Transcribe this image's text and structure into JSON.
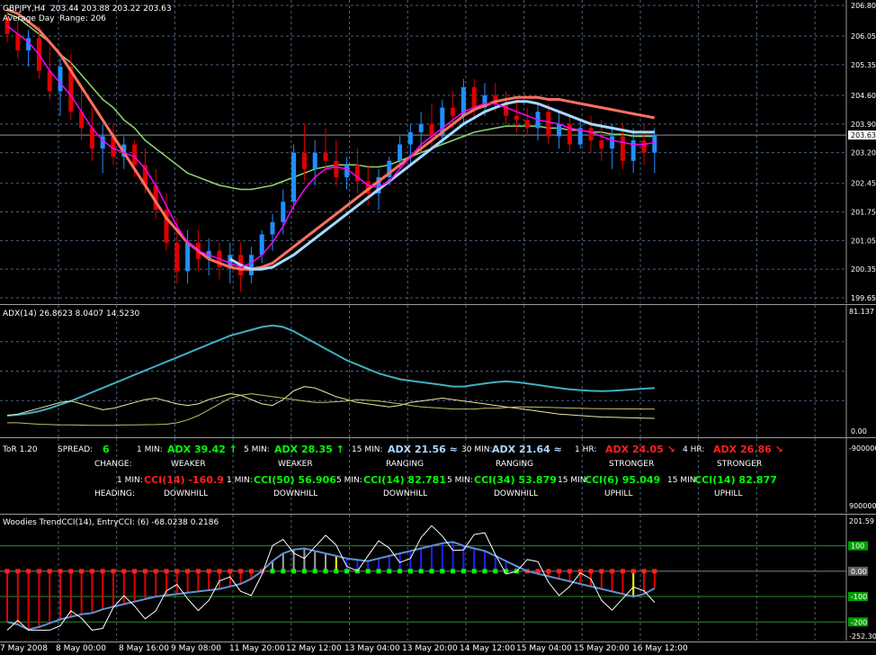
{
  "colors": {
    "bull": "#1e90ff",
    "bear": "#e00000",
    "fast_ma": "#ff00ff",
    "slow_ma": "#a8d8ff",
    "trend_ma": "#ff7060",
    "green_ma": "#90d870",
    "adx": "#40b0c0",
    "di": "#e8e8a0",
    "cci_bar_red": "#e00000",
    "cci_bar_blue": "#2020ff",
    "cci_bar_gray": "#a0a0a0",
    "cci_bar_yellow": "#ffff00",
    "cci_line": "#6090d0",
    "green": "#00ff00",
    "red": "#ff2020",
    "lightblue": "#b0d8ff"
  },
  "main": {
    "header_line1": "GBPJPY,H4  203.44 203.88 203.22 203.63",
    "header_line2": "Average Day  Range: 206",
    "current_price": "203.63",
    "price_ticks": [
      "206.80",
      "206.05",
      "205.35",
      "204.60",
      "203.90",
      "203.20",
      "202.45",
      "201.75",
      "201.05",
      "200.35",
      "199.65"
    ]
  },
  "adx_panel": {
    "header": "ADX(14) 26.8623 8.0407 14.5230",
    "top_tick": "81.137",
    "bottom_tick": "0.00"
  },
  "tor_panel": {
    "title": "ToR 1.20",
    "spread_label": "SPREAD:",
    "spread_value": "6",
    "change_label": "CHANGE:",
    "heading_label": "HEADING:",
    "tick_top": "-900000",
    "tick_bottom": "900000",
    "adx_cols": [
      {
        "tf": "1 MIN:",
        "adx": "ADX 39.42",
        "arrow": "↑",
        "state": "WEAKER",
        "color": "#00ff00"
      },
      {
        "tf": "5 MIN:",
        "adx": "ADX 28.35",
        "arrow": "↑",
        "state": "WEAKER",
        "color": "#00ff00"
      },
      {
        "tf": "15 MIN:",
        "adx": "ADX 21.56",
        "arrow": "≈",
        "state": "RANGING",
        "color": "#b0d8ff"
      },
      {
        "tf": "30 MIN:",
        "adx": "ADX 21.64",
        "arrow": "≈",
        "state": "RANGING",
        "color": "#b0d8ff"
      },
      {
        "tf": "1 HR:",
        "adx": "ADX 24.05",
        "arrow": "↘",
        "state": "STRONGER",
        "color": "#ff2020"
      },
      {
        "tf": "4 HR:",
        "adx": "ADX 26.86",
        "arrow": "↘",
        "state": "STRONGER",
        "color": "#ff2020"
      }
    ],
    "cci_cols": [
      {
        "tf": "1 MIN:",
        "cci": "CCI(14) -160.9",
        "state": "DOWNHILL",
        "color": "#ff2020"
      },
      {
        "tf": "1 MIN:",
        "cci": "CCI(50) 56.906",
        "state": "DOWNHILL",
        "color": "#00ff00"
      },
      {
        "tf": "5 MIN:",
        "cci": "CCI(14) 82.781",
        "state": "DOWNHILL",
        "color": "#00ff00"
      },
      {
        "tf": "5 MIN:",
        "cci": "CCI(34) 53.879",
        "state": "DOWNHILL",
        "color": "#00ff00"
      },
      {
        "tf": "15 MIN:",
        "cci": "CCI(6) 95.049",
        "state": "UPHILL",
        "color": "#00ff00"
      },
      {
        "tf": "15 MIN:",
        "cci": "CCI(14) 82.877",
        "state": "UPHILL",
        "color": "#00ff00"
      }
    ]
  },
  "cci_panel": {
    "header": "Woodies TrendCCI(14), EntryCCI: (6) -68.0238 0.2186",
    "ticks": [
      "201.59",
      "100",
      "0.00",
      "-100",
      "-200",
      "-252.30"
    ]
  },
  "x_labels": [
    "7 May 2008",
    "8 May 00:00",
    "8 May 16:00",
    "9 May 08:00",
    "11 May 20:00",
    "12 May 12:00",
    "13 May 04:00",
    "13 May 20:00",
    "14 May 12:00",
    "15 May 04:00",
    "15 May 20:00",
    "16 May 12:00"
  ],
  "chart_data": [
    {
      "type": "candlestick",
      "title": "GBPJPY,H4",
      "ylim": [
        199.65,
        206.8
      ],
      "grid": true,
      "candles": [
        {
          "o": 206.5,
          "h": 206.7,
          "l": 205.9,
          "c": 206.1
        },
        {
          "o": 206.1,
          "h": 206.4,
          "l": 205.5,
          "c": 205.7
        },
        {
          "o": 205.7,
          "h": 206.2,
          "l": 205.3,
          "c": 206.0
        },
        {
          "o": 206.0,
          "h": 206.3,
          "l": 205.0,
          "c": 205.2
        },
        {
          "o": 205.2,
          "h": 205.8,
          "l": 204.5,
          "c": 204.7
        },
        {
          "o": 204.7,
          "h": 205.5,
          "l": 204.1,
          "c": 205.3
        },
        {
          "o": 205.3,
          "h": 205.6,
          "l": 204.0,
          "c": 204.2
        },
        {
          "o": 204.2,
          "h": 204.8,
          "l": 203.5,
          "c": 203.8
        },
        {
          "o": 203.8,
          "h": 204.3,
          "l": 203.0,
          "c": 203.3
        },
        {
          "o": 203.3,
          "h": 203.9,
          "l": 202.7,
          "c": 203.6
        },
        {
          "o": 203.6,
          "h": 203.9,
          "l": 202.9,
          "c": 203.1
        },
        {
          "o": 203.1,
          "h": 203.6,
          "l": 202.8,
          "c": 203.4
        },
        {
          "o": 203.4,
          "h": 203.5,
          "l": 202.6,
          "c": 202.9
        },
        {
          "o": 202.9,
          "h": 203.3,
          "l": 202.2,
          "c": 202.4
        },
        {
          "o": 202.4,
          "h": 202.8,
          "l": 201.6,
          "c": 201.8
        },
        {
          "o": 201.8,
          "h": 202.2,
          "l": 200.8,
          "c": 201.0
        },
        {
          "o": 201.0,
          "h": 201.6,
          "l": 200.0,
          "c": 200.3
        },
        {
          "o": 200.3,
          "h": 201.3,
          "l": 200.0,
          "c": 201.0
        },
        {
          "o": 201.0,
          "h": 201.3,
          "l": 200.3,
          "c": 200.6
        },
        {
          "o": 200.6,
          "h": 201.1,
          "l": 200.2,
          "c": 200.8
        },
        {
          "o": 200.8,
          "h": 201.0,
          "l": 200.1,
          "c": 200.4
        },
        {
          "o": 200.4,
          "h": 201.0,
          "l": 200.0,
          "c": 200.7
        },
        {
          "o": 200.7,
          "h": 201.0,
          "l": 199.8,
          "c": 200.2
        },
        {
          "o": 200.2,
          "h": 200.9,
          "l": 200.0,
          "c": 200.7
        },
        {
          "o": 200.7,
          "h": 201.3,
          "l": 200.5,
          "c": 201.2
        },
        {
          "o": 201.2,
          "h": 201.7,
          "l": 200.8,
          "c": 201.5
        },
        {
          "o": 201.5,
          "h": 202.3,
          "l": 201.2,
          "c": 202.0
        },
        {
          "o": 202.0,
          "h": 203.4,
          "l": 201.8,
          "c": 203.2
        },
        {
          "o": 203.2,
          "h": 203.9,
          "l": 202.5,
          "c": 202.8
        },
        {
          "o": 202.8,
          "h": 203.5,
          "l": 202.4,
          "c": 203.2
        },
        {
          "o": 203.2,
          "h": 203.8,
          "l": 202.7,
          "c": 203.0
        },
        {
          "o": 203.0,
          "h": 203.5,
          "l": 202.4,
          "c": 202.6
        },
        {
          "o": 202.6,
          "h": 203.1,
          "l": 202.3,
          "c": 202.9
        },
        {
          "o": 202.9,
          "h": 203.3,
          "l": 202.2,
          "c": 202.5
        },
        {
          "o": 202.5,
          "h": 202.9,
          "l": 201.9,
          "c": 202.2
        },
        {
          "o": 202.2,
          "h": 202.8,
          "l": 201.8,
          "c": 202.6
        },
        {
          "o": 202.6,
          "h": 203.1,
          "l": 202.4,
          "c": 203.0
        },
        {
          "o": 203.0,
          "h": 203.6,
          "l": 202.8,
          "c": 203.4
        },
        {
          "o": 203.4,
          "h": 203.9,
          "l": 202.9,
          "c": 203.7
        },
        {
          "o": 203.7,
          "h": 204.2,
          "l": 203.2,
          "c": 203.9
        },
        {
          "o": 203.9,
          "h": 204.4,
          "l": 203.3,
          "c": 203.6
        },
        {
          "o": 203.6,
          "h": 204.5,
          "l": 203.4,
          "c": 204.3
        },
        {
          "o": 204.3,
          "h": 204.7,
          "l": 203.8,
          "c": 204.1
        },
        {
          "o": 204.1,
          "h": 205.0,
          "l": 203.9,
          "c": 204.8
        },
        {
          "o": 204.8,
          "h": 205.0,
          "l": 204.0,
          "c": 204.3
        },
        {
          "o": 204.3,
          "h": 204.9,
          "l": 204.1,
          "c": 204.6
        },
        {
          "o": 204.6,
          "h": 204.9,
          "l": 204.2,
          "c": 204.4
        },
        {
          "o": 204.4,
          "h": 204.7,
          "l": 203.9,
          "c": 204.1
        },
        {
          "o": 204.1,
          "h": 204.5,
          "l": 203.7,
          "c": 204.0
        },
        {
          "o": 204.0,
          "h": 204.3,
          "l": 203.6,
          "c": 203.8
        },
        {
          "o": 203.8,
          "h": 204.4,
          "l": 203.5,
          "c": 204.2
        },
        {
          "o": 204.2,
          "h": 204.4,
          "l": 203.4,
          "c": 203.6
        },
        {
          "o": 203.6,
          "h": 204.2,
          "l": 203.3,
          "c": 203.9
        },
        {
          "o": 203.9,
          "h": 204.1,
          "l": 203.2,
          "c": 203.4
        },
        {
          "o": 203.4,
          "h": 204.0,
          "l": 203.3,
          "c": 203.8
        },
        {
          "o": 203.8,
          "h": 204.1,
          "l": 203.2,
          "c": 203.5
        },
        {
          "o": 203.5,
          "h": 204.0,
          "l": 203.0,
          "c": 203.3
        },
        {
          "o": 203.3,
          "h": 203.9,
          "l": 202.8,
          "c": 203.6
        },
        {
          "o": 203.6,
          "h": 203.9,
          "l": 202.8,
          "c": 203.0
        },
        {
          "o": 203.0,
          "h": 203.8,
          "l": 202.7,
          "c": 203.5
        },
        {
          "o": 203.5,
          "h": 203.9,
          "l": 202.9,
          "c": 203.2
        },
        {
          "o": 203.2,
          "h": 203.8,
          "l": 202.7,
          "c": 203.63
        }
      ],
      "trend_ma": [
        206.7,
        206.6,
        206.4,
        206.2,
        205.9,
        205.6,
        205.2,
        204.8,
        204.4,
        204.0,
        203.6,
        203.2,
        202.8,
        202.4,
        202.0,
        201.6,
        201.3,
        201.0,
        200.8,
        200.6,
        200.5,
        200.4,
        200.35,
        200.35,
        200.4,
        200.5,
        200.7,
        200.9,
        201.1,
        201.3,
        201.5,
        201.7,
        201.9,
        202.1,
        202.3,
        202.5,
        202.7,
        202.9,
        203.1,
        203.3,
        203.5,
        203.7,
        203.9,
        204.1,
        204.25,
        204.35,
        204.45,
        204.5,
        204.55,
        204.55,
        204.55,
        204.5,
        204.5,
        204.45,
        204.4,
        204.35,
        204.3,
        204.25,
        204.2,
        204.15,
        204.1,
        204.05
      ],
      "slow_ma": [
        null,
        null,
        null,
        null,
        null,
        null,
        null,
        null,
        null,
        null,
        null,
        null,
        null,
        null,
        null,
        null,
        null,
        null,
        null,
        null,
        null,
        200.6,
        200.45,
        200.35,
        200.35,
        200.4,
        200.55,
        200.7,
        200.9,
        201.1,
        201.3,
        201.5,
        201.7,
        201.9,
        202.1,
        202.3,
        202.5,
        202.7,
        202.9,
        203.1,
        203.3,
        203.5,
        203.7,
        203.9,
        204.05,
        204.2,
        204.3,
        204.4,
        204.45,
        204.45,
        204.4,
        204.3,
        204.2,
        204.1,
        204.0,
        203.9,
        203.85,
        203.8,
        203.75,
        203.7,
        203.7,
        203.7
      ],
      "green_ma": [
        206.6,
        206.5,
        206.3,
        206.1,
        205.9,
        205.6,
        205.4,
        205.1,
        204.8,
        204.5,
        204.3,
        204.0,
        203.8,
        203.5,
        203.3,
        203.1,
        202.9,
        202.7,
        202.6,
        202.5,
        202.4,
        202.35,
        202.3,
        202.3,
        202.35,
        202.4,
        202.5,
        202.6,
        202.7,
        202.8,
        202.85,
        202.9,
        202.9,
        202.9,
        202.85,
        202.85,
        202.9,
        203.0,
        203.1,
        203.2,
        203.3,
        203.4,
        203.5,
        203.6,
        203.7,
        203.75,
        203.8,
        203.85,
        203.85,
        203.85,
        203.85,
        203.8,
        203.8,
        203.75,
        203.75,
        203.7,
        203.7,
        203.65,
        203.65,
        203.6,
        203.6,
        203.6
      ],
      "fast_ma": [
        206.3,
        206.1,
        205.9,
        205.6,
        205.2,
        204.9,
        204.6,
        204.2,
        203.8,
        203.5,
        203.3,
        203.2,
        203.1,
        202.8,
        202.4,
        201.9,
        201.4,
        201.0,
        200.8,
        200.7,
        200.6,
        200.5,
        200.4,
        200.5,
        200.7,
        201.0,
        201.4,
        201.9,
        202.3,
        202.6,
        202.8,
        202.85,
        202.8,
        202.6,
        202.4,
        202.35,
        202.5,
        202.8,
        203.1,
        203.4,
        203.6,
        203.8,
        204.0,
        204.2,
        204.3,
        204.4,
        204.4,
        204.3,
        204.2,
        204.1,
        204.0,
        203.95,
        203.9,
        203.8,
        203.75,
        203.7,
        203.6,
        203.5,
        203.45,
        203.4,
        203.4,
        203.45
      ]
    },
    {
      "type": "line",
      "title": "ADX(14)",
      "ylim": [
        0,
        81.137
      ],
      "series": [
        {
          "name": "ADX",
          "values": [
            10,
            10.5,
            11.5,
            13,
            15,
            17.5,
            20,
            23,
            26,
            29,
            32,
            35,
            38,
            41,
            44,
            47,
            50,
            53,
            56,
            59,
            62,
            65,
            67,
            69,
            71,
            72,
            71,
            68,
            64,
            60,
            56,
            52,
            48,
            45,
            42,
            39,
            37,
            35,
            34,
            33,
            32,
            31,
            30,
            30,
            31,
            32,
            33,
            33.5,
            33,
            32,
            31,
            30,
            29,
            28,
            27.5,
            27,
            26.8,
            27,
            27.5,
            28,
            28.5,
            28.9
          ]
        },
        {
          "name": "+DI",
          "values": [
            10,
            11,
            13,
            15,
            17,
            19,
            20,
            18,
            16,
            14,
            15,
            17,
            19,
            21,
            22,
            20,
            18,
            17,
            18,
            21,
            23,
            25,
            24,
            21,
            18,
            17,
            21,
            27,
            30,
            29,
            26,
            23,
            21,
            19,
            18,
            17,
            16,
            17,
            19,
            20,
            21,
            22,
            21,
            20,
            19,
            18,
            17,
            16,
            15,
            14,
            13,
            12,
            11,
            10.5,
            10,
            9.5,
            9,
            8.8,
            8.6,
            8.4,
            8.2,
            8.04
          ]
        },
        {
          "name": "-DI",
          "values": [
            5,
            5,
            4.5,
            4,
            3.8,
            3.6,
            3.5,
            3.4,
            3.3,
            3.2,
            3.3,
            3.5,
            3.6,
            3.7,
            3.8,
            4,
            5,
            7,
            10,
            14,
            18,
            22,
            24,
            25,
            24,
            23,
            22,
            21,
            20,
            19,
            19,
            19.5,
            20,
            21,
            20.5,
            20,
            19,
            18,
            17,
            16,
            15.5,
            15,
            14.5,
            14.5,
            14.5,
            15,
            15,
            15.5,
            16,
            16,
            15.8,
            15.6,
            15.4,
            15.2,
            15,
            14.8,
            14.7,
            14.6,
            14.55,
            14.53,
            14.52,
            14.52
          ]
        }
      ]
    },
    {
      "type": "bar",
      "title": "Woodies TrendCCI(14), EntryCCI: (6)",
      "ylim": [
        -252.3,
        201.59
      ],
      "cci14": [
        -200,
        -210,
        -230,
        -220,
        -205,
        -190,
        -180,
        -170,
        -165,
        -150,
        -140,
        -130,
        -120,
        -110,
        -100,
        -95,
        -90,
        -85,
        -80,
        -75,
        -70,
        -60,
        -50,
        -30,
        0,
        40,
        70,
        85,
        90,
        80,
        70,
        60,
        50,
        45,
        40,
        50,
        60,
        70,
        80,
        90,
        100,
        110,
        115,
        100,
        90,
        80,
        60,
        40,
        20,
        0,
        -10,
        -20,
        -30,
        -40,
        -50,
        -60,
        -70,
        -80,
        -90,
        -100,
        -90,
        -68
      ]
    }
  ]
}
